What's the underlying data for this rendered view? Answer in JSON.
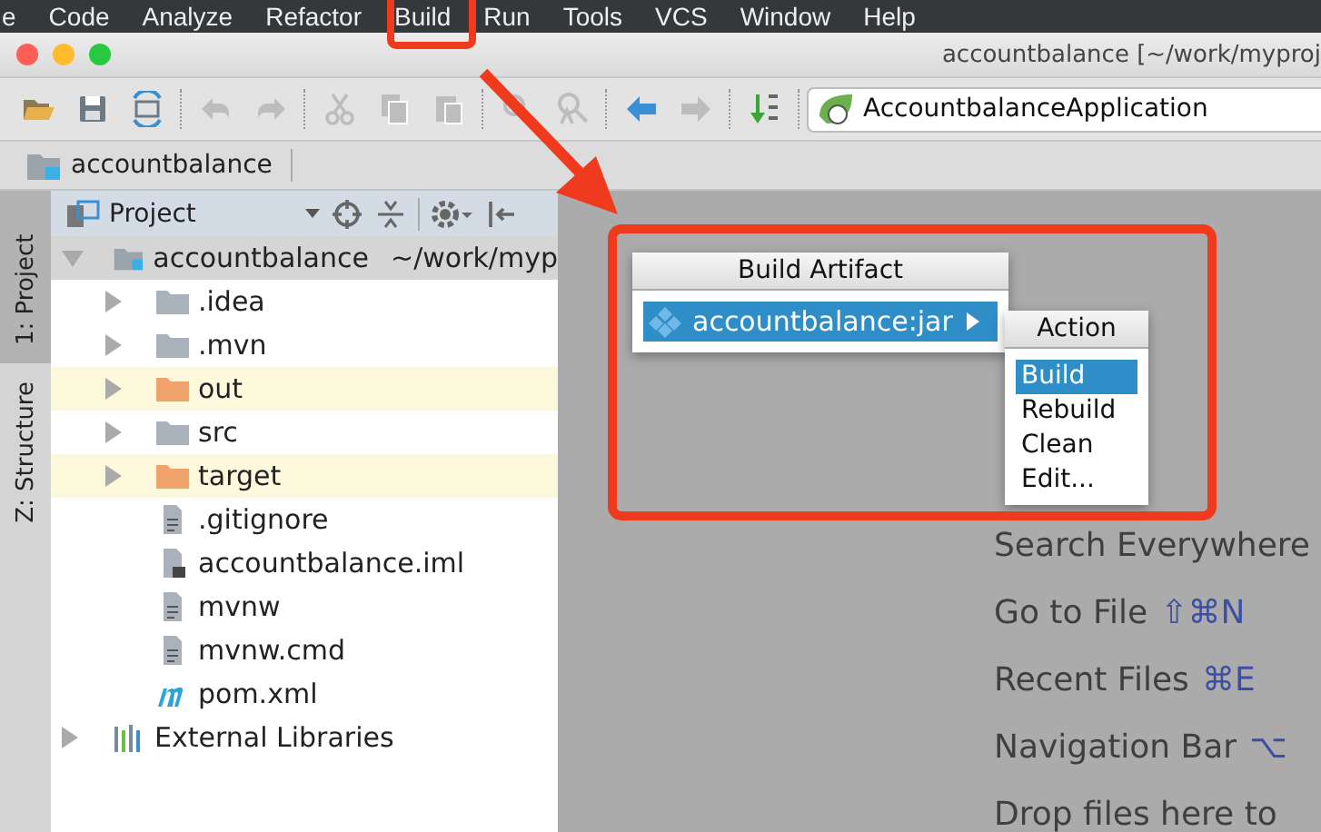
{
  "menu_bar": [
    "e",
    "Code",
    "Analyze",
    "Refactor",
    "Build",
    "Run",
    "Tools",
    "VCS",
    "Window",
    "Help"
  ],
  "window": {
    "title": "accountbalance [~/work/myproj"
  },
  "toolbar": [
    [
      {
        "kind": "open",
        "disabled": false
      },
      {
        "kind": "save",
        "disabled": false
      },
      {
        "kind": "sync",
        "disabled": false
      }
    ],
    [
      {
        "kind": "undo",
        "disabled": true
      },
      {
        "kind": "redo",
        "disabled": true
      }
    ],
    [
      {
        "kind": "cut",
        "disabled": true
      },
      {
        "kind": "copy",
        "disabled": true
      },
      {
        "kind": "paste",
        "disabled": true
      }
    ],
    [
      {
        "kind": "find",
        "disabled": true
      },
      {
        "kind": "replace",
        "disabled": true
      }
    ],
    [
      {
        "kind": "back",
        "disabled": false
      },
      {
        "kind": "forward",
        "disabled": true
      }
    ],
    [
      {
        "kind": "sort",
        "disabled": false
      }
    ]
  ],
  "run_config": {
    "label": "AccountbalanceApplication"
  },
  "breadcrumb": [
    "accountbalance"
  ],
  "side_tabs": [
    {
      "label": "1: Project",
      "selected": true
    },
    {
      "label": "Z: Structure",
      "selected": false
    }
  ],
  "project_panel": {
    "title": "Project",
    "tree": [
      {
        "label": "accountbalance",
        "path": "~/work/myp",
        "kind": "module",
        "expanded": true,
        "children": [
          {
            "label": ".idea",
            "kind": "folder",
            "expanded": false
          },
          {
            "label": ".mvn",
            "kind": "folder",
            "expanded": false
          },
          {
            "label": "out",
            "kind": "excluded",
            "expanded": false
          },
          {
            "label": "src",
            "kind": "folder",
            "expanded": false
          },
          {
            "label": "target",
            "kind": "excluded",
            "expanded": false
          },
          {
            "label": ".gitignore",
            "kind": "file"
          },
          {
            "label": "accountbalance.iml",
            "kind": "iml"
          },
          {
            "label": "mvnw",
            "kind": "file"
          },
          {
            "label": "mvnw.cmd",
            "kind": "file"
          },
          {
            "label": "pom.xml",
            "kind": "maven"
          }
        ]
      },
      {
        "label": "External Libraries",
        "kind": "libraries",
        "expanded": false
      }
    ]
  },
  "build_artifact_popup": {
    "title": "Build Artifact",
    "items": [
      {
        "label": "accountbalance:jar",
        "selected": true
      }
    ]
  },
  "action_popup": {
    "title": "Action",
    "items": [
      {
        "label": "Build",
        "selected": true
      },
      {
        "label": "Rebuild",
        "selected": false
      },
      {
        "label": "Clean",
        "selected": false
      },
      {
        "label": "Edit...",
        "selected": false
      }
    ]
  },
  "editor_hints": [
    {
      "label": "Search Everywhere"
    },
    {
      "label": "Go to File",
      "shortcut": "⇧⌘N"
    },
    {
      "label": "Recent Files",
      "shortcut": "⌘E"
    },
    {
      "label": "Navigation Bar",
      "shortcut": "⌥"
    },
    {
      "label": "Drop files here to"
    }
  ]
}
